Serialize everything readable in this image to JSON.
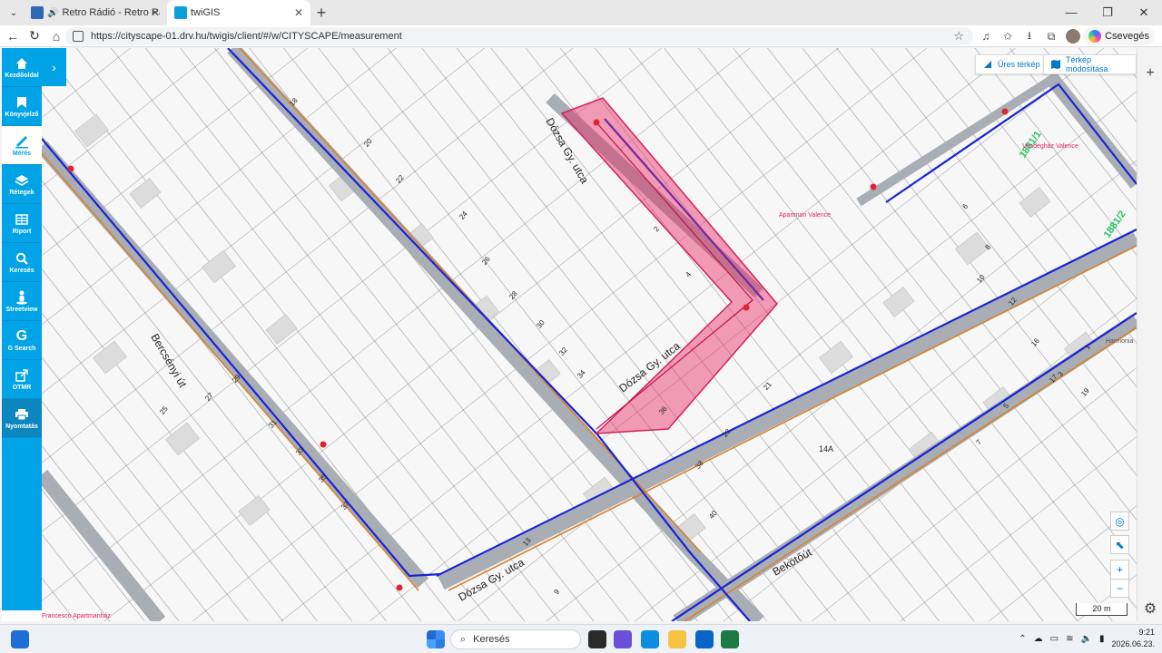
{
  "browser": {
    "tabs": [
      {
        "title": "Retro Rádió - Retro Rádió ON",
        "active": false
      },
      {
        "title": "twiGIS",
        "active": true
      }
    ],
    "url": "https://cityscape-01.drv.hu/twigis/client/#/w/CITYSCAPE/measurement",
    "copilot_label": "Csevegés"
  },
  "sidebar": {
    "items": [
      {
        "label": "Kezdőoldal",
        "icon": "home-icon"
      },
      {
        "label": "Könyvjelző",
        "icon": "bookmark-icon"
      },
      {
        "label": "Mérés",
        "icon": "ruler-icon"
      },
      {
        "label": "Rétegek",
        "icon": "layers-icon"
      },
      {
        "label": "Riport",
        "icon": "table-icon"
      },
      {
        "label": "Keresés",
        "icon": "search-icon"
      },
      {
        "label": "Streetview",
        "icon": "person-icon"
      },
      {
        "label": "G Search",
        "icon": "google-icon"
      },
      {
        "label": "OTMR",
        "icon": "share-icon"
      },
      {
        "label": "Nyomtatás",
        "icon": "printer-icon"
      }
    ]
  },
  "map": {
    "buttons": {
      "empty_map": "Üres térkép",
      "modify_map": "Térkép módosítása"
    },
    "scale_label": "20 m",
    "labels": {
      "street_dozsa": "Dózsa Gy. utca",
      "street_bercsenyi": "Bercsényi út",
      "street_bekotout": "Bekötőút",
      "parcel_1881_1": "1881/1",
      "parcel_1881_2": "1881/2",
      "poi_apartman": "Apartman Valence",
      "poi_vendeghaz": "Vendégház Valence",
      "poi_harmonia": "Harmonia",
      "poi_francesco": "Francesco Apartmanház",
      "house_14a": "14A"
    },
    "house_numbers": [
      "18",
      "20",
      "22",
      "24",
      "26",
      "28",
      "30",
      "32",
      "34",
      "36",
      "38",
      "40",
      "2",
      "4",
      "6",
      "8",
      "10",
      "12",
      "16",
      "17",
      "19",
      "21",
      "23",
      "25",
      "27",
      "29",
      "31",
      "33",
      "35",
      "37",
      "1",
      "3",
      "5",
      "7",
      "9",
      "13"
    ]
  },
  "taskbar": {
    "search_placeholder": "Keresés",
    "time": "9:21",
    "date": "2026.06.23."
  }
}
